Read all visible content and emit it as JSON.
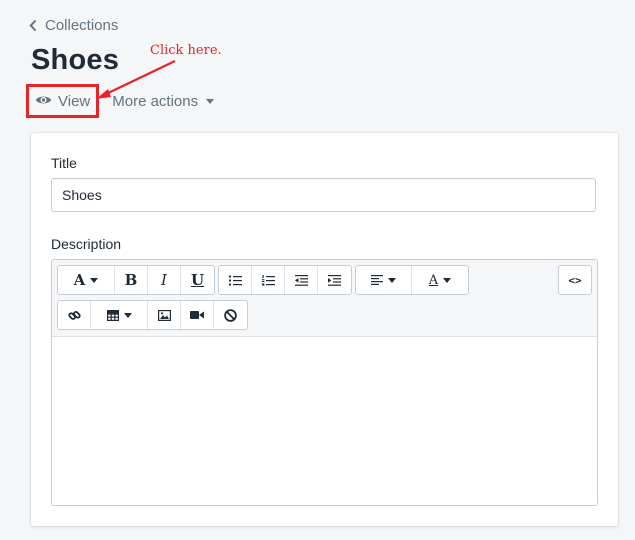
{
  "breadcrumb": {
    "label": "Collections",
    "icon": "chevron-left-icon"
  },
  "page": {
    "title": "Shoes"
  },
  "actions": {
    "view_label": "View",
    "view_icon": "eye-icon",
    "more_label": "More actions",
    "more_icon": "caret-down-icon"
  },
  "annotation": {
    "text": "Click here.",
    "color": "#e5252a"
  },
  "form": {
    "title_label": "Title",
    "title_value": "Shoes",
    "description_label": "Description"
  },
  "toolbar": {
    "font_style_glyph": "A",
    "bold_glyph": "B",
    "italic_glyph": "I",
    "underline_glyph": "U",
    "text_color_glyph": "A",
    "source_glyph": "<>",
    "icons": [
      "font-style-icon",
      "bold-icon",
      "italic-icon",
      "underline-icon",
      "bullet-list-icon",
      "numbered-list-icon",
      "outdent-icon",
      "indent-icon",
      "align-left-icon",
      "text-color-icon",
      "source-code-icon",
      "link-icon",
      "table-icon",
      "image-icon",
      "video-icon",
      "clear-formatting-icon"
    ]
  },
  "colors": {
    "accent_red": "#e5252a",
    "muted_text": "#637381",
    "border": "#c4cdd5",
    "background": "#f4f6f8"
  }
}
